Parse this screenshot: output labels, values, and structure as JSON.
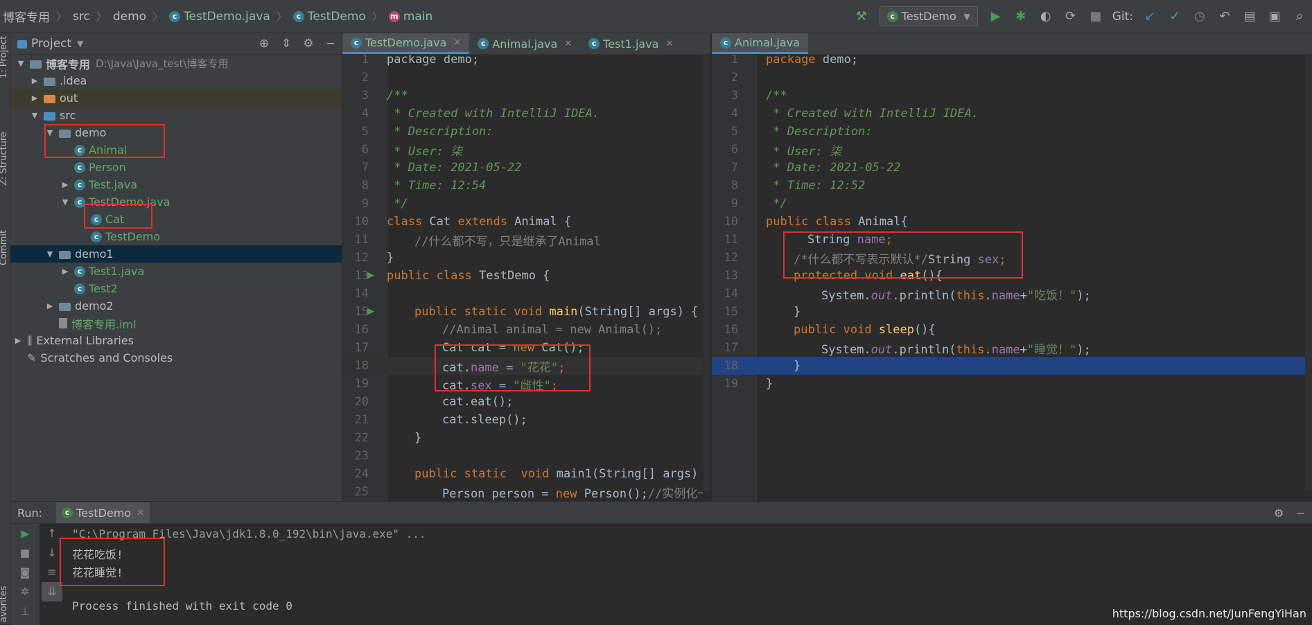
{
  "breadcrumb": {
    "items": [
      {
        "label": "博客专用",
        "kind": "project"
      },
      {
        "label": "src",
        "kind": "folder"
      },
      {
        "label": "demo",
        "kind": "folder"
      },
      {
        "label": "TestDemo.java",
        "kind": "java"
      },
      {
        "label": "TestDemo",
        "kind": "class"
      },
      {
        "label": "main",
        "kind": "method"
      }
    ]
  },
  "toolbar": {
    "run_config": "TestDemo",
    "git_label": "Git:"
  },
  "left_stripe": {
    "project": "1: Project",
    "structure": "Z: Structure",
    "commit": "Commit",
    "favorites": "avorites"
  },
  "project_panel": {
    "title": "Project",
    "root": {
      "label": "博客专用",
      "path": "D:\\Java\\Java_test\\博客专用"
    },
    "items": [
      {
        "label": ".idea"
      },
      {
        "label": "out"
      },
      {
        "label": "src"
      },
      {
        "label": "demo"
      },
      {
        "label": "Animal"
      },
      {
        "label": "Person"
      },
      {
        "label": "Test.java"
      },
      {
        "label": "TestDemo.java"
      },
      {
        "label": "Cat"
      },
      {
        "label": "TestDemo"
      },
      {
        "label": "demo1"
      },
      {
        "label": "Test1.java"
      },
      {
        "label": "Test2"
      },
      {
        "label": "demo2"
      },
      {
        "label": "博客专用.iml"
      },
      {
        "label": "External Libraries"
      },
      {
        "label": "Scratches and Consoles"
      }
    ]
  },
  "left_tabs": [
    {
      "label": "TestDemo.java"
    },
    {
      "label": "Animal.java"
    },
    {
      "label": "Test1.java"
    }
  ],
  "right_tabs": [
    {
      "label": "Animal.java"
    }
  ],
  "left_editor": {
    "line_numbers": [
      "1",
      "2",
      "3",
      "4",
      "5",
      "6",
      "7",
      "8",
      "9",
      "10",
      "11",
      "12",
      "13",
      "14",
      "15",
      "16",
      "17",
      "18",
      "19",
      "20",
      "21",
      "22",
      "23",
      "24",
      "25"
    ],
    "lines": {
      "l1": "package demo;",
      "l3": "/**",
      "l4": " * Created with IntelliJ IDEA.",
      "l5": " * Description:",
      "l6": " * User: 柒",
      "l7": " * Date: 2021-05-22",
      "l8": " * Time: 12:54",
      "l9": " */",
      "l10_kw1": "class",
      "l10_name": " Cat ",
      "l10_kw2": "extends",
      "l10_rest": " Animal {",
      "l11": "//什么都不写，只是继承了Animal",
      "l12": "}",
      "l13_kw": "public class",
      "l13_rest": " TestDemo {",
      "l15_kw": "public static void",
      "l15_m": " main",
      "l15_rest": "(String[] args) {",
      "l16": "//Animal animal = new Animal();",
      "l17_a": "Cat cat = ",
      "l17_kw": "new",
      "l17_b": " Cat();",
      "l18_a": "cat.",
      "l18_f": "name",
      "l18_b": " = ",
      "l18_s": "\"花花\"",
      "l18_c": ";",
      "l19_a": "cat.",
      "l19_f": "sex",
      "l19_b": " = ",
      "l19_s": "\"雌性\"",
      "l19_c": ";",
      "l20": "cat.eat();",
      "l21": "cat.sleep();",
      "l22": "}",
      "l24_kw": "public static  void",
      "l24_rest": " main1(String[] args) {",
      "l25_a": "Person person = ",
      "l25_kw": "new",
      "l25_b": " Person();",
      "l25_c": "//实例化一"
    }
  },
  "right_editor": {
    "line_numbers": [
      "1",
      "2",
      "3",
      "4",
      "5",
      "6",
      "7",
      "8",
      "9",
      "10",
      "11",
      "12",
      "13",
      "14",
      "15",
      "16",
      "17",
      "18",
      "19"
    ],
    "lines": {
      "l1_kw": "package",
      "l1_rest": " demo;",
      "l3": "/**",
      "l4": " * Created with IntelliJ IDEA.",
      "l5": " * Description:",
      "l6": " * User: 柒",
      "l7": " * Date: 2021-05-22",
      "l8": " * Time: 12:52",
      "l9": " */",
      "l10_kw": "public class",
      "l10_rest": " Animal{",
      "l11_a": "String ",
      "l11_f": "name",
      "l11_b": ";",
      "l12_c": "/*什么都不写表示默认*/",
      "l12_a": "String ",
      "l12_f": "sex",
      "l12_b": ";",
      "l13_kw": "protected void",
      "l13_m": " eat",
      "l13_rest": "(){",
      "l14_a": "System.",
      "l14_o": "out",
      "l14_b": ".println(",
      "l14_kw": "this",
      "l14_c": ".",
      "l14_f": "name",
      "l14_d": "+",
      "l14_s": "\"吃饭！\"",
      "l14_e": ");",
      "l15": "}",
      "l16_kw": "public void",
      "l16_m": " sleep",
      "l16_rest": "(){",
      "l17_a": "System.",
      "l17_o": "out",
      "l17_b": ".println(",
      "l17_kw": "this",
      "l17_c": ".",
      "l17_f": "name",
      "l17_d": "+",
      "l17_s": "\"睡觉！\"",
      "l17_e": ");",
      "l18": "}",
      "l19": "}"
    }
  },
  "run_panel": {
    "label": "Run:",
    "tab": "TestDemo",
    "output": [
      "\"C:\\Program Files\\Java\\jdk1.8.0_192\\bin\\java.exe\" ...",
      "花花吃饭!",
      "花花睡觉!",
      "",
      "Process finished with exit code 0"
    ]
  },
  "watermark": "https://blog.csdn.net/JunFengYiHan",
  "colors": {
    "keyword": "#cc7832",
    "string": "#6a8759",
    "field": "#9876aa",
    "doc_comment": "#629755",
    "annotation_box": "#e0302c"
  }
}
